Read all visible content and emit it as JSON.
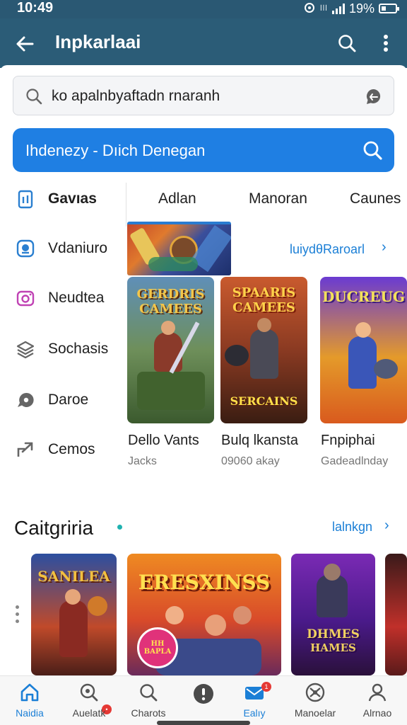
{
  "status_bar": {
    "time": "10:49",
    "mini_text": "ꟾꟾꟾ",
    "battery": "19%"
  },
  "app_bar": {
    "title": "Inpkarlaai"
  },
  "search": {
    "placeholder": "ko apalnbyaftadn rnaranh"
  },
  "promo_bar": {
    "label": "Ihdenezy - Dıich  Denegan"
  },
  "sidebar": {
    "items": [
      {
        "label": "Gavıas",
        "icon": "phone-icon"
      },
      {
        "label": "Vdaniuro",
        "icon": "chat-bubble-icon"
      },
      {
        "label": "Neudtea",
        "icon": "camera-icon"
      },
      {
        "label": "Sochasis",
        "icon": "layers-icon"
      },
      {
        "label": "Daroe",
        "icon": "speech-icon"
      },
      {
        "label": "Cemos",
        "icon": "share-arrow-icon"
      }
    ]
  },
  "tabs": [
    {
      "label": "Adlan"
    },
    {
      "label": "Manoran"
    },
    {
      "label": "Caunes"
    }
  ],
  "featured": {
    "see_more": "luiydθRaroarl"
  },
  "game_cards": [
    {
      "poster_text": "GERDRIS CAMEES",
      "title": "Dello Vants",
      "subtitle": "Jacks"
    },
    {
      "poster_text": "SPAARIS CAMEES",
      "poster_sub": "SERCAINS",
      "title": "Bulq lkansta",
      "subtitle": "09060 akay"
    },
    {
      "poster_text": "DUCREUG",
      "title": "Fnpiphai",
      "subtitle": "Gadeadlnday"
    }
  ],
  "categories": {
    "title": "Caitgriria",
    "see_more": "lalnkgn",
    "cards": [
      {
        "poster_text": "SANILEA"
      },
      {
        "poster_text": "ERESXINSS",
        "badge": "HH BAPLA"
      },
      {
        "poster_text": "DHMES",
        "poster_sub": "HAMES"
      },
      {
        "poster_text": ""
      }
    ]
  },
  "bottom_nav": {
    "items": [
      {
        "label": "Naidia",
        "icon": "home-icon",
        "active": true
      },
      {
        "label": "Auelatk",
        "icon": "search-badge-icon",
        "active": false
      },
      {
        "label": "Charots",
        "icon": "search-icon",
        "active": false
      },
      {
        "label": "",
        "icon": "info-icon",
        "active": false
      },
      {
        "label": "Ealıy",
        "icon": "mail-icon",
        "active": false,
        "badge": "1"
      },
      {
        "label": "Manoelar",
        "icon": "globe-icon",
        "active": false
      },
      {
        "label": "Alrnao",
        "icon": "profile-icon",
        "active": false
      }
    ]
  },
  "colors": {
    "app_bar": "#2b5c77",
    "accent": "#1f7fe3",
    "link": "#1b7fd6"
  }
}
